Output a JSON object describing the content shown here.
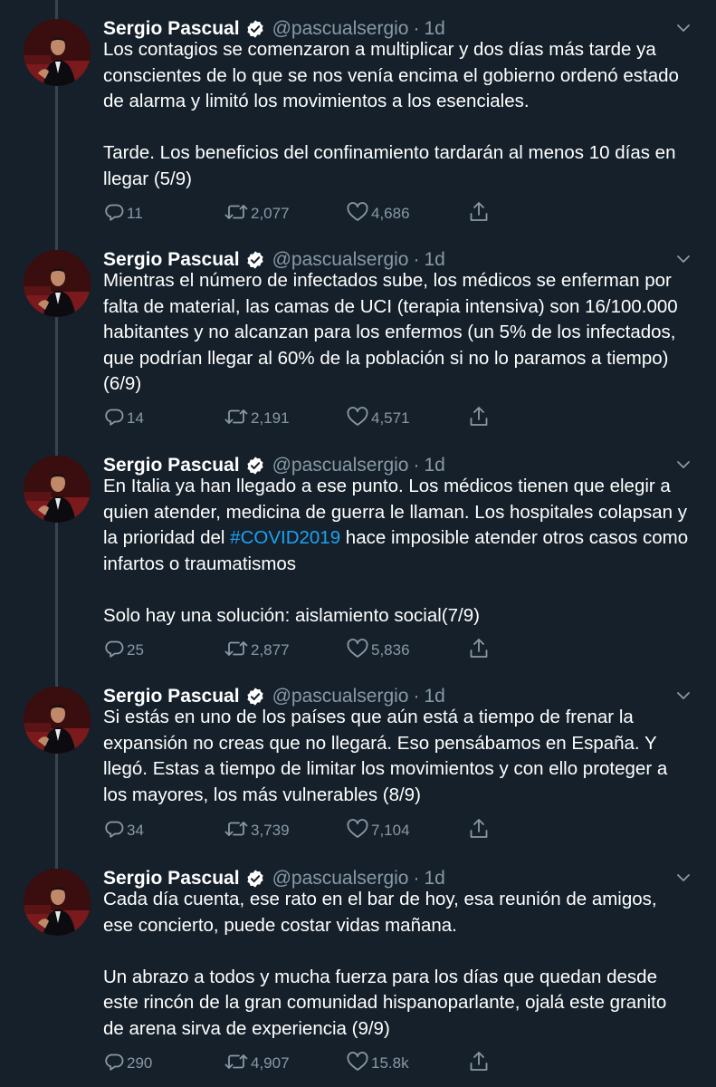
{
  "author": {
    "name": "Sergio Pascual",
    "handle": "@pascualsergio",
    "separator": "·",
    "verified_icon": "verified-badge-icon"
  },
  "tweets": [
    {
      "time": "1d",
      "paragraphs": [
        "Los contagios se comenzaron a multiplicar y dos días más tarde ya conscientes de lo que se nos venía encima el gobierno ordenó estado de alarma y limitó los movimientos a los esenciales.",
        "Tarde. Los beneficios del confinamiento tardarán al menos 10 días en llegar (5/9)"
      ],
      "replies": "11",
      "retweets": "2,077",
      "likes": "4,686"
    },
    {
      "time": "1d",
      "paragraphs": [
        "Mientras el número de infectados sube, los médicos se enferman por falta de material, las camas de UCI (terapia intensiva) son 16/100.000 habitantes y no alcanzan para los enfermos (un 5% de los infectados, que podrían llegar al 60% de la población si no lo paramos a tiempo) (6/9)"
      ],
      "replies": "14",
      "retweets": "2,191",
      "likes": "4,571"
    },
    {
      "time": "1d",
      "paragraphs": [
        {
          "before": "En Italia ya han llegado a ese punto. Los médicos tienen que elegir a quien atender, medicina de guerra le llaman. Los hospitales colapsan y la prioridad del ",
          "hashtag": "#COVID2019",
          "after": " hace imposible atender otros casos como infartos o traumatismos"
        },
        "Solo hay una solución: aislamiento social(7/9)"
      ],
      "replies": "25",
      "retweets": "2,877",
      "likes": "5,836"
    },
    {
      "time": "1d",
      "paragraphs": [
        "Si estás en uno de los países que aún está a tiempo de frenar la expansión no creas que no llegará. Eso pensábamos en España. Y llegó. Estas a tiempo de limitar los movimientos y con ello proteger a los mayores, los más vulnerables (8/9)"
      ],
      "replies": "34",
      "retweets": "3,739",
      "likes": "7,104"
    },
    {
      "time": "1d",
      "paragraphs": [
        "Cada día cuenta, ese rato en el bar de hoy, esa reunión de amigos, ese concierto, puede costar vidas mañana.",
        "Un abrazo a todos y mucha fuerza para los días que quedan desde este rincón de la gran comunidad hispanoparlante, ojalá este granito de arena sirva de experiencia (9/9)"
      ],
      "replies": "290",
      "retweets": "4,907",
      "likes": "15.8k"
    }
  ],
  "icons": {
    "reply": "reply-icon",
    "retweet": "retweet-icon",
    "like": "like-icon",
    "share": "share-icon",
    "menu": "chevron-down-icon",
    "avatar": "avatar"
  },
  "colors": {
    "background": "#15202b",
    "text": "#ffffff",
    "muted": "#8899a6",
    "link": "#1da1f2",
    "thread_line": "#38444d"
  }
}
